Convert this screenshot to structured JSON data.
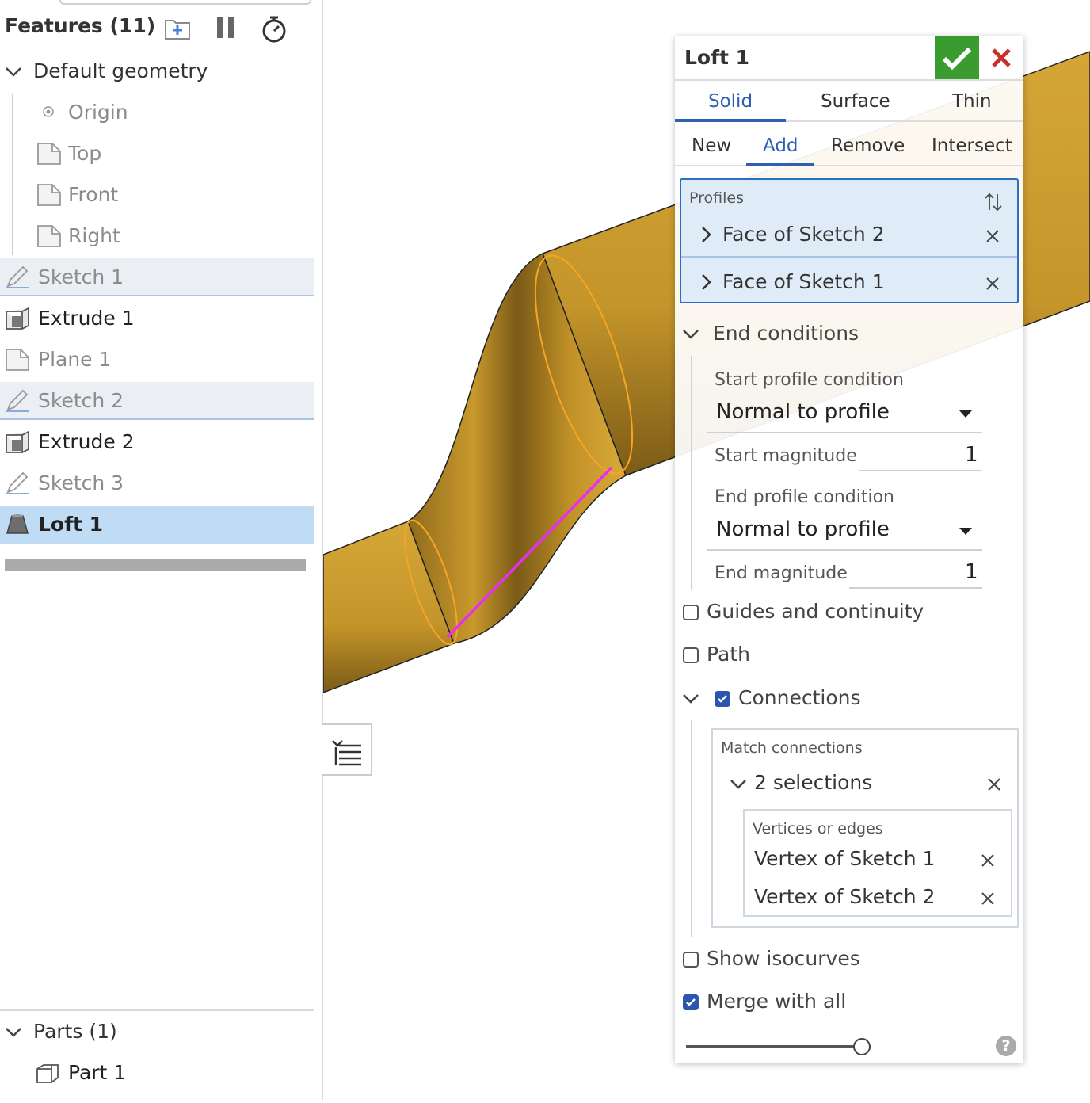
{
  "tree": {
    "title": "Features (11)",
    "header_icons": [
      "folder-add-icon",
      "pause-icon",
      "stopwatch-icon"
    ],
    "default_geometry": "Default geometry",
    "geometry_items": [
      "Origin",
      "Top",
      "Front",
      "Right"
    ],
    "features": [
      {
        "label": "Sketch 1",
        "icon": "sketch-icon"
      },
      {
        "label": "Extrude 1",
        "icon": "extrude-icon"
      },
      {
        "label": "Plane 1",
        "icon": "plane-icon"
      },
      {
        "label": "Sketch 2",
        "icon": "sketch-icon"
      },
      {
        "label": "Extrude 2",
        "icon": "extrude-icon"
      },
      {
        "label": "Sketch 3",
        "icon": "sketch-icon"
      },
      {
        "label": "Loft 1",
        "icon": "loft-icon"
      }
    ],
    "parts_header": "Parts (1)",
    "parts": [
      "Part 1"
    ]
  },
  "dialog": {
    "title": "Loft 1",
    "body_tabs": [
      "Solid",
      "Surface",
      "Thin"
    ],
    "active_body_tab": "Solid",
    "op_tabs": [
      "New",
      "Add",
      "Remove",
      "Intersect"
    ],
    "active_op_tab": "Add",
    "profiles_label": "Profiles",
    "profiles": [
      "Face of Sketch 2",
      "Face of Sketch 1"
    ],
    "end_conditions": "End conditions",
    "start_condition_label": "Start profile condition",
    "start_condition_value": "Normal to profile",
    "start_magnitude_label": "Start magnitude",
    "start_magnitude_value": "1",
    "end_condition_label": "End profile condition",
    "end_condition_value": "Normal to profile",
    "end_magnitude_label": "End magnitude",
    "end_magnitude_value": "1",
    "guides_label": "Guides and continuity",
    "guides_checked": false,
    "path_label": "Path",
    "path_checked": false,
    "connections_label": "Connections",
    "connections_checked": true,
    "match_connections_label": "Match connections",
    "selections_label": "2 selections",
    "vertices_label": "Vertices or edges",
    "vertices": [
      "Vertex of Sketch 1",
      "Vertex of Sketch 2"
    ],
    "isocurves_label": "Show isocurves",
    "isocurves_checked": false,
    "merge_label": "Merge with all",
    "merge_checked": true,
    "slider_fraction": 1.0
  },
  "colors": {
    "accent": "#2d5fb3",
    "ok_green": "#3a9b2f",
    "cancel_red": "#c8302c",
    "part_gold": "#c79a2b",
    "connection_line": "#e82ef0",
    "profile_outline": "#f5a623"
  }
}
